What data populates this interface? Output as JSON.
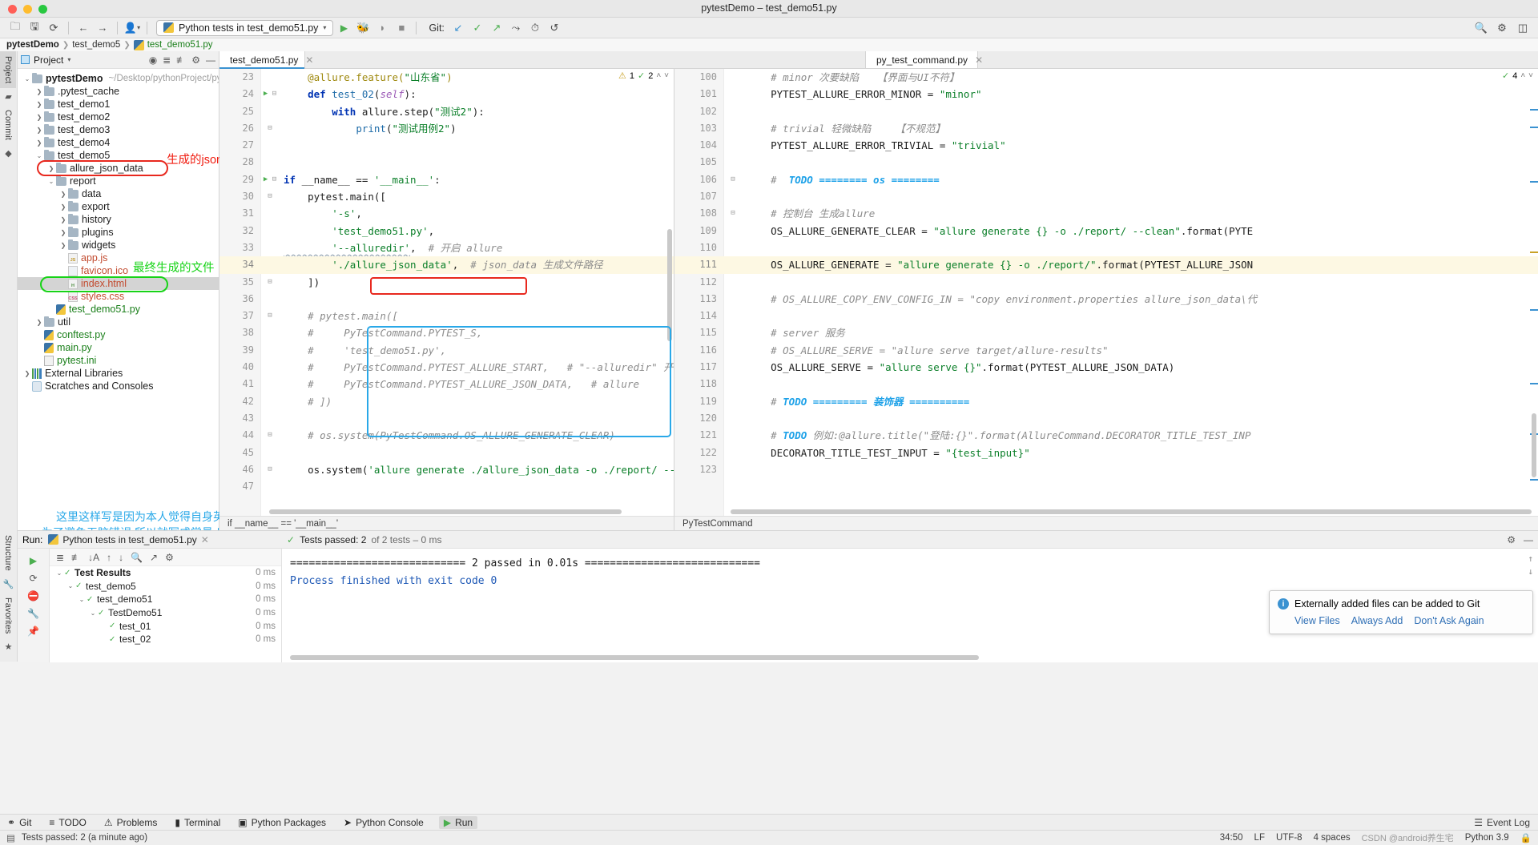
{
  "window": {
    "title": "pytestDemo – test_demo51.py"
  },
  "toolbar": {
    "run_config": "Python tests in test_demo51.py",
    "git_label": "Git:",
    "icons": [
      "open-folder-icon",
      "save-icon",
      "sync-icon",
      "back-arrow-icon",
      "forward-arrow-icon",
      "vcs-user-icon",
      "run-icon",
      "debug-icon",
      "coverage-icon",
      "stop-icon",
      "update-project-icon",
      "commit-icon",
      "push-icon",
      "branch-icon",
      "history-icon",
      "rollback-icon",
      "search-everywhere-icon",
      "settings-icon",
      "project-structure-icon"
    ]
  },
  "breadcrumb": {
    "project": "pytestDemo",
    "folder": "test_demo5",
    "file": "test_demo51.py"
  },
  "left_strip": {
    "tabs": [
      "Project",
      "Commit"
    ],
    "bottom_tabs": [
      "Structure",
      "Favorites"
    ]
  },
  "project_panel": {
    "title": "Project",
    "tree": [
      {
        "depth": 0,
        "arrow": "down",
        "icon": "folder",
        "name": "pytestDemo",
        "bold": true,
        "path": "~/Desktop/pythonProject/pytes"
      },
      {
        "depth": 1,
        "arrow": "right",
        "icon": "folder",
        "name": ".pytest_cache"
      },
      {
        "depth": 1,
        "arrow": "right",
        "icon": "folder",
        "name": "test_demo1"
      },
      {
        "depth": 1,
        "arrow": "right",
        "icon": "folder",
        "name": "test_demo2"
      },
      {
        "depth": 1,
        "arrow": "right",
        "icon": "folder",
        "name": "test_demo3"
      },
      {
        "depth": 1,
        "arrow": "right",
        "icon": "folder",
        "name": "test_demo4"
      },
      {
        "depth": 1,
        "arrow": "down",
        "icon": "folder",
        "name": "test_demo5"
      },
      {
        "depth": 2,
        "arrow": "right",
        "icon": "folder",
        "name": "allure_json_data"
      },
      {
        "depth": 2,
        "arrow": "down",
        "icon": "folder",
        "name": "report"
      },
      {
        "depth": 3,
        "arrow": "right",
        "icon": "folder",
        "name": "data"
      },
      {
        "depth": 3,
        "arrow": "right",
        "icon": "folder",
        "name": "export"
      },
      {
        "depth": 3,
        "arrow": "right",
        "icon": "folder",
        "name": "history"
      },
      {
        "depth": 3,
        "arrow": "right",
        "icon": "folder",
        "name": "plugins"
      },
      {
        "depth": 3,
        "arrow": "right",
        "icon": "folder",
        "name": "widgets"
      },
      {
        "depth": 3,
        "arrow": "none",
        "icon": "js",
        "name": "app.js",
        "color": "red"
      },
      {
        "depth": 3,
        "arrow": "none",
        "icon": "ico",
        "name": "favicon.ico",
        "color": "red"
      },
      {
        "depth": 3,
        "arrow": "none",
        "icon": "html",
        "name": "index.html",
        "color": "red",
        "selected": true
      },
      {
        "depth": 3,
        "arrow": "none",
        "icon": "css",
        "name": "styles.css",
        "color": "red"
      },
      {
        "depth": 2,
        "arrow": "none",
        "icon": "py",
        "name": "test_demo51.py",
        "color": "green"
      },
      {
        "depth": 1,
        "arrow": "right",
        "icon": "folder",
        "name": "util"
      },
      {
        "depth": 1,
        "arrow": "none",
        "icon": "py",
        "name": "conftest.py",
        "color": "green"
      },
      {
        "depth": 1,
        "arrow": "none",
        "icon": "py",
        "name": "main.py",
        "color": "green"
      },
      {
        "depth": 1,
        "arrow": "none",
        "icon": "ini",
        "name": "pytest.ini",
        "color": "green"
      },
      {
        "depth": 0,
        "arrow": "right",
        "icon": "lib",
        "name": "External Libraries"
      },
      {
        "depth": 0,
        "arrow": "none",
        "icon": "scratch",
        "name": "Scratches and Consoles"
      }
    ]
  },
  "annotations": {
    "red_tree_label": "生成的jsonData文件",
    "red_tree_label_short": "生成的json",
    "green_tree_label": "最终生成的文件",
    "blue_note_line1": "这里这样写是因为本人觉得自身英语有限,",
    "blue_note_line2": "为了避免无脑错误,所以就写成常量,以后直接调用很方便"
  },
  "editor_left": {
    "tab": "test_demo51.py",
    "inspect": {
      "warnings": "1",
      "checks": "2"
    },
    "status": "if __name__ == '__main__'",
    "lines": [
      {
        "n": "23",
        "mark": "",
        "tokens": [
          [
            "dec",
            "    @allure.feature("
          ],
          [
            "s",
            "\"山东省\""
          ],
          [
            "dec",
            ")"
          ]
        ]
      },
      {
        "n": "24",
        "mark": "run-fold",
        "tokens": [
          [
            "k",
            "    def "
          ],
          [
            "fn",
            "test_02"
          ],
          [
            "pl",
            "("
          ],
          [
            "self",
            "self"
          ],
          [
            "pl",
            "):"
          ]
        ]
      },
      {
        "n": "25",
        "mark": "",
        "tokens": [
          [
            "k",
            "        with "
          ],
          [
            "pl",
            "allure.step("
          ],
          [
            "s",
            "\"测试2\""
          ],
          [
            "pl",
            "):"
          ]
        ]
      },
      {
        "n": "26",
        "mark": "fold",
        "tokens": [
          [
            "pl",
            "            "
          ],
          [
            "fn",
            "print"
          ],
          [
            "pl",
            "("
          ],
          [
            "s",
            "\"测试用例2\""
          ],
          [
            "pl",
            ")"
          ]
        ]
      },
      {
        "n": "27",
        "mark": "",
        "tokens": []
      },
      {
        "n": "28",
        "mark": "",
        "tokens": []
      },
      {
        "n": "29",
        "mark": "run-fold",
        "tokens": [
          [
            "k",
            "if "
          ],
          [
            "pl",
            "__name__ == "
          ],
          [
            "s",
            "'__main__'"
          ],
          [
            "pl",
            ":"
          ]
        ]
      },
      {
        "n": "30",
        "mark": "fold",
        "tokens": [
          [
            "pl",
            "    pytest.main(["
          ]
        ]
      },
      {
        "n": "31",
        "mark": "",
        "tokens": [
          [
            "s",
            "        '-s'"
          ],
          [
            "pl",
            ","
          ]
        ]
      },
      {
        "n": "32",
        "mark": "",
        "tokens": [
          [
            "s",
            "        'test_demo51.py'"
          ],
          [
            "pl",
            ","
          ]
        ]
      },
      {
        "n": "33",
        "mark": "",
        "tokens": [
          [
            "s-wavy",
            "        '--alluredir'"
          ],
          [
            "pl",
            ","
          ],
          [
            "c",
            "  # 开启 allure"
          ]
        ]
      },
      {
        "n": "34",
        "mark": "",
        "hl": true,
        "tokens": [
          [
            "s",
            "        './allure_json_data'"
          ],
          [
            "pl",
            ","
          ],
          [
            "c",
            "  # json_data 生成文件路径"
          ]
        ]
      },
      {
        "n": "35",
        "mark": "fold",
        "tokens": [
          [
            "pl",
            "    ])"
          ]
        ]
      },
      {
        "n": "36",
        "mark": "",
        "tokens": []
      },
      {
        "n": "37",
        "mark": "fold",
        "tokens": [
          [
            "c",
            "    # pytest.main(["
          ]
        ]
      },
      {
        "n": "38",
        "mark": "",
        "tokens": [
          [
            "c",
            "    #     PyTestCommand.PYTEST_S,"
          ]
        ]
      },
      {
        "n": "39",
        "mark": "",
        "tokens": [
          [
            "c",
            "    #     'test_demo51.py',"
          ]
        ]
      },
      {
        "n": "40",
        "mark": "",
        "tokens": [
          [
            "c",
            "    #     PyTestCommand.PYTEST_ALLURE_START,   # \"--alluredir\" 开启"
          ]
        ]
      },
      {
        "n": "41",
        "mark": "",
        "tokens": [
          [
            "c",
            "    #     PyTestCommand.PYTEST_ALLURE_JSON_DATA,   # allure"
          ]
        ]
      },
      {
        "n": "42",
        "mark": "",
        "tokens": [
          [
            "c",
            "    # ])"
          ]
        ]
      },
      {
        "n": "43",
        "mark": "",
        "tokens": []
      },
      {
        "n": "44",
        "mark": "fold",
        "tokens": [
          [
            "c",
            "    # os.system(PyTestCommand.OS_ALLURE_GENERATE_CLEAR)"
          ]
        ]
      },
      {
        "n": "45",
        "mark": "",
        "tokens": []
      },
      {
        "n": "46",
        "mark": "fold",
        "tokens": [
          [
            "pl",
            "    os.system("
          ],
          [
            "s",
            "'allure generate ./allure_json_data -o ./report/ --"
          ]
        ]
      },
      {
        "n": "47",
        "mark": "",
        "tokens": []
      }
    ]
  },
  "editor_right": {
    "tab": "py_test_command.py",
    "inspect": {
      "checks": "4"
    },
    "status": "PyTestCommand",
    "lines": [
      {
        "n": "100",
        "mark": "",
        "tokens": [
          [
            "c",
            "    # minor 次要缺陷   【界面与UI不符】"
          ]
        ]
      },
      {
        "n": "101",
        "mark": "",
        "tokens": [
          [
            "pl",
            "    PYTEST_ALLURE_ERROR_MINOR = "
          ],
          [
            "s",
            "\"minor\""
          ]
        ]
      },
      {
        "n": "102",
        "mark": "",
        "tokens": []
      },
      {
        "n": "103",
        "mark": "",
        "tokens": [
          [
            "c",
            "    # trivial 轻微缺陷    【不规范】"
          ]
        ]
      },
      {
        "n": "104",
        "mark": "",
        "tokens": [
          [
            "pl",
            "    PYTEST_ALLURE_ERROR_TRIVIAL = "
          ],
          [
            "s",
            "\"trivial\""
          ]
        ]
      },
      {
        "n": "105",
        "mark": "",
        "tokens": []
      },
      {
        "n": "106",
        "mark": "fold",
        "tokens": [
          [
            "c",
            "    #  "
          ],
          [
            "todo",
            "TODO ======== os ========"
          ]
        ]
      },
      {
        "n": "107",
        "mark": "",
        "tokens": []
      },
      {
        "n": "108",
        "mark": "fold",
        "tokens": [
          [
            "c",
            "    # 控制台 生成allure"
          ]
        ]
      },
      {
        "n": "109",
        "mark": "",
        "tokens": [
          [
            "pl",
            "    OS_ALLURE_GENERATE_CLEAR = "
          ],
          [
            "s",
            "\"allure generate {} -o ./report/ --clean\""
          ],
          [
            "pl",
            ".format(PYTE"
          ]
        ]
      },
      {
        "n": "110",
        "mark": "",
        "tokens": []
      },
      {
        "n": "111",
        "mark": "",
        "hl": true,
        "tokens": [
          [
            "pl",
            "    OS_ALLURE_GENERATE = "
          ],
          [
            "s",
            "\"allure generate {} -o ./report/\""
          ],
          [
            "pl",
            ".format(PYTEST_ALLURE_JSON"
          ]
        ]
      },
      {
        "n": "112",
        "mark": "",
        "tokens": []
      },
      {
        "n": "113",
        "mark": "",
        "tokens": [
          [
            "c",
            "    # OS_ALLURE_COPY_ENV_CONFIG_IN = \"copy environment.properties allure_json_data\\代"
          ]
        ]
      },
      {
        "n": "114",
        "mark": "",
        "tokens": []
      },
      {
        "n": "115",
        "mark": "",
        "tokens": [
          [
            "c",
            "    # server 服务"
          ]
        ]
      },
      {
        "n": "116",
        "mark": "",
        "tokens": [
          [
            "c",
            "    # OS_ALLURE_SERVE = \"allure serve target/allure-results\""
          ]
        ]
      },
      {
        "n": "117",
        "mark": "",
        "tokens": [
          [
            "pl",
            "    OS_ALLURE_SERVE = "
          ],
          [
            "s",
            "\"allure serve {}\""
          ],
          [
            "pl",
            ".format(PYTEST_ALLURE_JSON_DATA)"
          ]
        ]
      },
      {
        "n": "118",
        "mark": "",
        "tokens": []
      },
      {
        "n": "119",
        "mark": "",
        "tokens": [
          [
            "c",
            "    # "
          ],
          [
            "todo",
            "TODO ========= 装饰器 =========="
          ]
        ]
      },
      {
        "n": "120",
        "mark": "",
        "tokens": []
      },
      {
        "n": "121",
        "mark": "",
        "tokens": [
          [
            "c",
            "    # "
          ],
          [
            "todo",
            "TODO"
          ],
          [
            "c",
            " 例如:@allure.title(\"登陆:{}\".format(AllureCommand.DECORATOR_TITLE_TEST_INP"
          ]
        ]
      },
      {
        "n": "122",
        "mark": "",
        "tokens": [
          [
            "pl",
            "    DECORATOR_TITLE_TEST_INPUT = "
          ],
          [
            "s",
            "\"{test_input}\""
          ]
        ]
      },
      {
        "n": "123",
        "mark": "",
        "tokens": []
      }
    ]
  },
  "run_panel": {
    "label": "Run:",
    "tab": "Python tests in test_demo51.py",
    "summary_prefix": "Tests passed: 2",
    "summary_suffix": "of 2 tests – 0 ms",
    "tree": [
      {
        "depth": 0,
        "name": "Test Results",
        "ms": "0 ms",
        "bold": true
      },
      {
        "depth": 1,
        "name": "test_demo5",
        "ms": "0 ms"
      },
      {
        "depth": 2,
        "name": "test_demo51",
        "ms": "0 ms"
      },
      {
        "depth": 3,
        "name": "TestDemo51",
        "ms": "0 ms"
      },
      {
        "depth": 4,
        "name": "test_01",
        "ms": "0 ms"
      },
      {
        "depth": 4,
        "name": "test_02",
        "ms": "0 ms"
      }
    ],
    "console": [
      "============================ 2 passed in 0.01s ============================",
      "",
      "Process finished with exit code 0"
    ]
  },
  "notification": {
    "message": "Externally added files can be added to Git",
    "actions": [
      "View Files",
      "Always Add",
      "Don't Ask Again"
    ]
  },
  "bottom_tools": [
    {
      "label": "Git",
      "icon": "git-icon"
    },
    {
      "label": "TODO",
      "icon": "todo-icon"
    },
    {
      "label": "Problems",
      "icon": "problems-icon"
    },
    {
      "label": "Terminal",
      "icon": "terminal-icon"
    },
    {
      "label": "Python Packages",
      "icon": "packages-icon"
    },
    {
      "label": "Python Console",
      "icon": "console-icon"
    },
    {
      "label": "Run",
      "icon": "run-icon",
      "active": true
    }
  ],
  "status_bar": {
    "message": "Tests passed: 2 (a minute ago)",
    "caret": "34:50",
    "line_sep": "LF",
    "encoding": "UTF-8",
    "indent": "4 spaces",
    "interpreter": "Python 3.9",
    "event_log": "Event Log",
    "watermark": "CSDN @android养生宅"
  }
}
